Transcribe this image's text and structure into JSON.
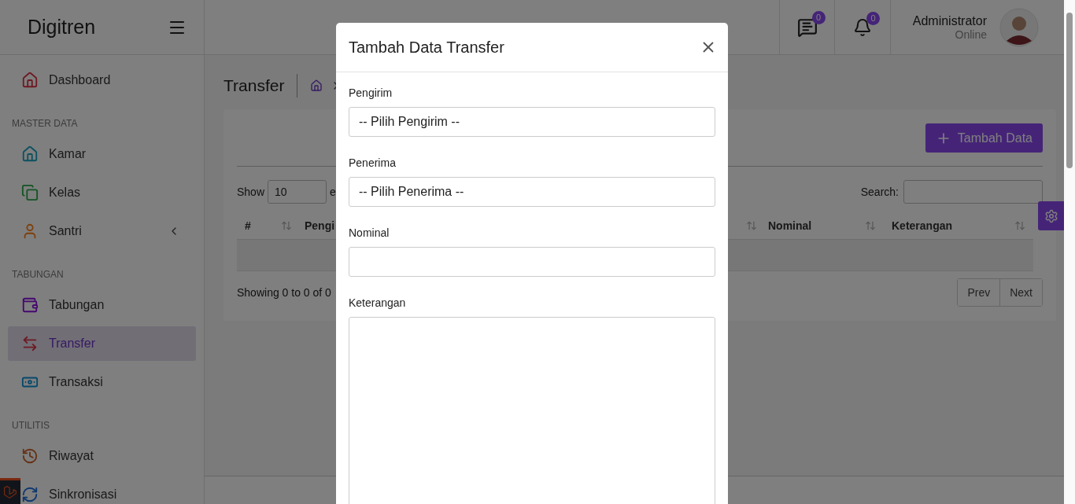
{
  "brand": "Digitren",
  "topbar": {
    "messages_badge": "0",
    "notifications_badge": "0",
    "user_name": "Administrator",
    "user_status": "Online"
  },
  "sidebar": {
    "items": [
      {
        "kind": "link",
        "label": "Dashboard",
        "color": "#6e1a22",
        "selected": false
      },
      {
        "kind": "header",
        "label": "MASTER DATA"
      },
      {
        "kind": "link",
        "label": "Kamar",
        "color": "#0b5160",
        "selected": false
      },
      {
        "kind": "link",
        "label": "Kelas",
        "color": "#145324",
        "selected": false
      },
      {
        "kind": "group",
        "label": "Santri",
        "color": "#7e3f0a",
        "selected": false,
        "expanded": false
      },
      {
        "kind": "header",
        "label": "TABUNGAN"
      },
      {
        "kind": "link",
        "label": "Tabungan",
        "color": "#450870",
        "selected": false
      },
      {
        "kind": "link",
        "label": "Transfer",
        "color": "#6e1a22",
        "selected": true
      },
      {
        "kind": "link",
        "label": "Transaksi",
        "color": "#05476a",
        "selected": false
      },
      {
        "kind": "header",
        "label": "UTILITIS"
      },
      {
        "kind": "link",
        "label": "Riwayat",
        "color": "#643015",
        "selected": false
      },
      {
        "kind": "link",
        "label": "Sinkronisasi",
        "color": "#0d3770",
        "selected": false
      }
    ]
  },
  "page": {
    "title": "Transfer"
  },
  "card": {
    "add_button": "Tambah Data",
    "length_label": "Show",
    "length_value": "10",
    "length_suffix": "e",
    "search_label": "Search:",
    "columns_left": [
      "#",
      "Pengi"
    ],
    "columns_right": [
      "Nominal",
      "Keterangan"
    ],
    "info": "Showing 0 to 0 of 0",
    "pagination": [
      "Prev",
      "Next"
    ]
  },
  "modal": {
    "title": "Tambah Data Transfer",
    "fields": [
      {
        "kind": "select",
        "label": "Pengirim",
        "value": "-- Pilih Pengirim --"
      },
      {
        "kind": "select",
        "label": "Penerima",
        "value": "-- Pilih Penerima --"
      },
      {
        "kind": "input",
        "label": "Nominal"
      },
      {
        "kind": "textarea",
        "label": "Keterangan"
      }
    ]
  }
}
